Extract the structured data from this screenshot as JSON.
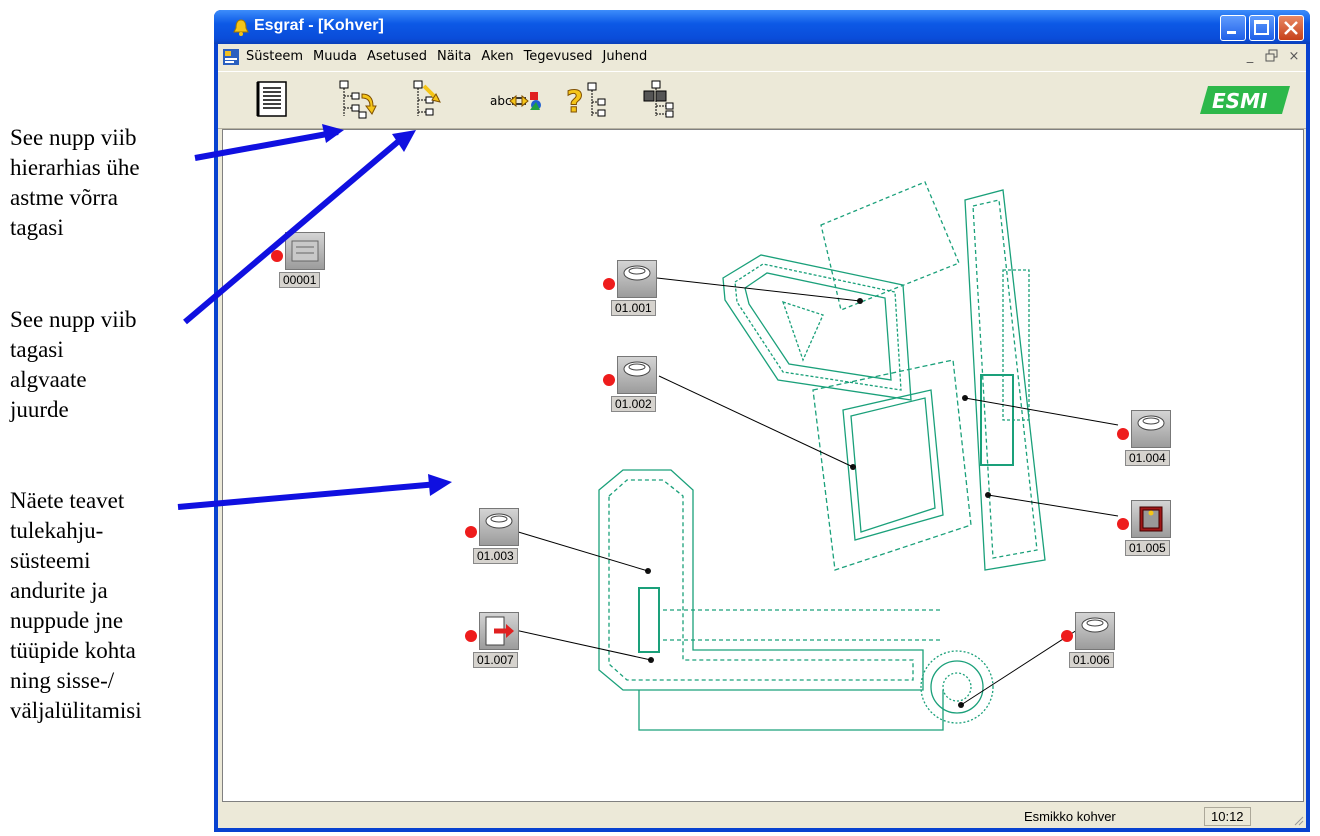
{
  "annotations": {
    "back_one_level": "See nupp viib\nhierarhias ühe\nastme võrra\ntagasi",
    "back_to_home": "See nupp viib\ntagasi\nalgvaate\njuurde",
    "device_info": "Näete teavet\ntulekahju-\nsüsteemi\nandurite ja\nnuppude  jne\ntüüpide  kohta\nning sisse-/\nväljalülitamisi"
  },
  "window": {
    "title": "Esgraf - [Kohver]",
    "menu": [
      "Süsteem",
      "Muuda",
      "Asetused",
      "Näita",
      "Aken",
      "Tegevused",
      "Juhend"
    ],
    "mdi_buttons": [
      "_",
      "ᐯ",
      "×"
    ]
  },
  "toolbar": {
    "buttons": [
      {
        "name": "list-view-button",
        "icon": "list-icon"
      },
      {
        "name": "back-one-level-button",
        "icon": "hierarchy-back-icon"
      },
      {
        "name": "back-to-home-button",
        "icon": "hierarchy-home-icon"
      },
      {
        "name": "text-toggle-button",
        "icon": "text-swap-icon"
      },
      {
        "name": "help-tree-button",
        "icon": "help-hierarchy-icon"
      },
      {
        "name": "device-tree-button",
        "icon": "device-hierarchy-icon"
      }
    ],
    "text_button_label": "abc",
    "logo": "ESMI"
  },
  "devices": [
    {
      "id": "00001",
      "type": "panel"
    },
    {
      "id": "01.001",
      "type": "smoke-detector"
    },
    {
      "id": "01.002",
      "type": "smoke-detector"
    },
    {
      "id": "01.003",
      "type": "smoke-detector"
    },
    {
      "id": "01.004",
      "type": "smoke-detector"
    },
    {
      "id": "01.005",
      "type": "manual-call-point"
    },
    {
      "id": "01.006",
      "type": "smoke-detector"
    },
    {
      "id": "01.007",
      "type": "door-exit"
    }
  ],
  "status": {
    "text": "Esmikko kohver",
    "time": "10:12"
  },
  "colors": {
    "titlebar": "#0a4cd9",
    "floorplan": "#1aa07a",
    "status_dot": "#ee1c1c",
    "arrow": "#1010e0",
    "logo": "#2db84a"
  }
}
